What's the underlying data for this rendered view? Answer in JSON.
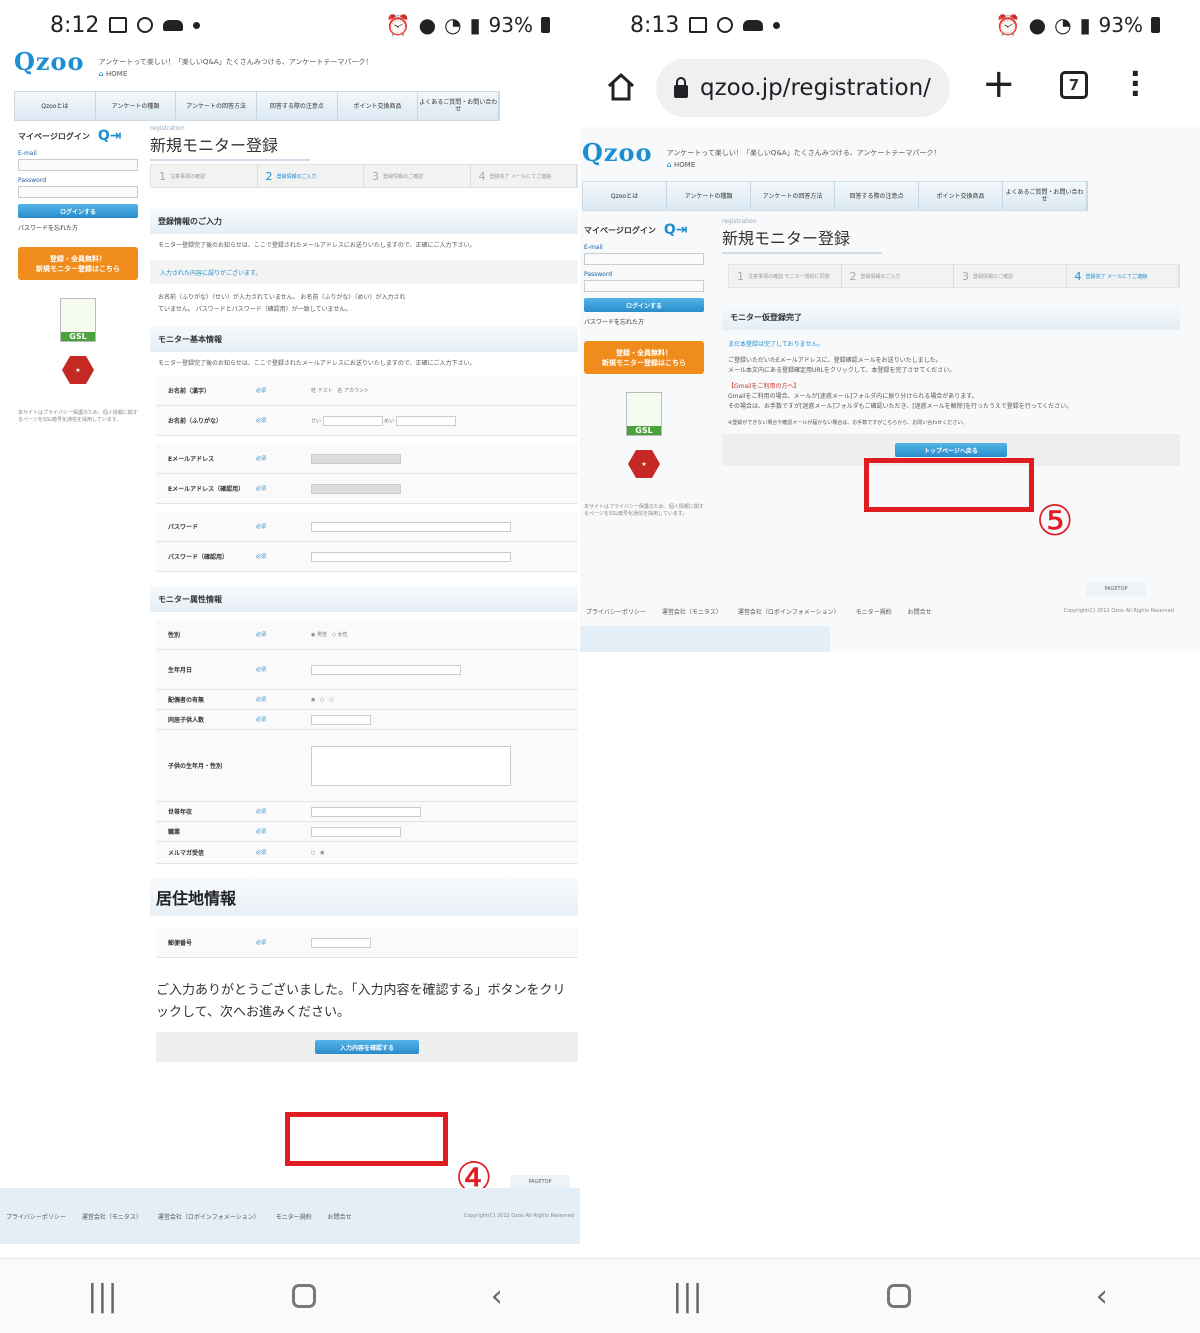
{
  "left": {
    "status": {
      "time": "8:12",
      "battery": "93%"
    },
    "site": {
      "logo_main": "Qzoo",
      "tagline": "アンケートって楽しい！「楽しいQ&A」たくさんみつける、アンケートテーマパーク！",
      "home": "HOME",
      "menu": [
        "Qzooとは",
        "アンケートの種類",
        "アンケートの回答方法",
        "回答する際の注意点",
        "ポイント交換商品",
        "よくあるご質問・お問い合わせ"
      ],
      "login_title": "マイページログイン",
      "email_label": "E-mail",
      "password_label": "Password",
      "login_button": "ログインする",
      "forgot": "パスワードを忘れた方",
      "signup_line1": "登録・全員無料！",
      "signup_line2": "新規モニター登録はこちら",
      "badge_gsl": "GSL",
      "side_note": "本サイトはプライバシー保護のため、個人情報に関するページをSSL暗号化通信を採用しています。",
      "reg_small": "registration",
      "page_title": "新規モニター登録",
      "steps": [
        {
          "label": "STEP",
          "num": "1",
          "text": "注意事項の確認"
        },
        {
          "label": "STEP",
          "num": "2",
          "text": "登録情報のご入力"
        },
        {
          "label": "STEP",
          "num": "3",
          "text": "登録情報のご確認"
        },
        {
          "label": "STEP",
          "num": "4",
          "text": "登録完了 メールにてご連絡"
        }
      ],
      "sec1": "登録情報のご入力",
      "sec1_text": "モニター登録完了後のお知らせは、ここで登録されたメールアドレスにお送りいたしますので、正確にご入力下さい。",
      "warning": "入力された内容に誤りがございます。",
      "errors": "お名前（ふりがな）（せい）が入力されていません。 お名前（ふりがな）（めい）が入力されていません。 パスワードとパスワード（確認用）が一致していません。",
      "sec2": "モニター基本情報",
      "sec2_text": "モニター登録完了後のお知らせは、ここで登録されたメールアドレスにお送りいたしますので、正確にご入力下さい。",
      "required": "必須",
      "basic_rows": [
        "お名前（漢字）",
        "お名前（ふりがな）",
        "Eメールアドレス",
        "Eメールアドレス（確認用）",
        "パスワード",
        "パスワード（確認用）"
      ],
      "name_values": [
        "テスト",
        "アカウント"
      ],
      "sec3": "モニター属性情報",
      "attr_rows": [
        "性別",
        "生年月日",
        "配偶者の有無",
        "同居子供人数",
        "子供の生年月・性別",
        "世帯年収",
        "職業",
        "メルマガ受信"
      ],
      "sec4": "居住地情報",
      "zip_label": "郵便番号",
      "thanks": "ご入力ありがとうございました。「入力内容を確認する」ボタンをクリックして、次へお進みください。",
      "submit_button": "入力内容を確認する",
      "step_marker": "④",
      "pagetop": "PAGETOP",
      "footer_links": [
        "プライバシーポリシー",
        "運営会社（モニタス）",
        "運営会社（ロボインフォメーション）",
        "モニター規約",
        "お問合せ"
      ],
      "copyright": "Copyright(C) 2012 Qzoo All Rights Reserved"
    }
  },
  "right": {
    "status": {
      "time": "8:13",
      "battery": "93%"
    },
    "browser": {
      "url": "qzoo.jp/registration/",
      "tab_count": "7"
    },
    "site": {
      "logo_main": "Qzoo",
      "tagline": "アンケートって楽しい！「楽しいQ&A」たくさんみつける、アンケートテーマパーク！",
      "home": "HOME",
      "menu": [
        "Qzooとは",
        "アンケートの種類",
        "アンケートの回答方法",
        "回答する際の注意点",
        "ポイント交換商品",
        "よくあるご質問・お問い合わせ"
      ],
      "login_title": "マイページログイン",
      "email_label": "E-mail",
      "password_label": "Password",
      "login_button": "ログインする",
      "forgot": "パスワードを忘れた方",
      "signup_line1": "登録・全員無料！",
      "signup_line2": "新規モニター登録はこちら",
      "badge_gsl": "GSL",
      "side_note": "本サイトはプライバシー保護のため、個人情報に関するページをSSL暗号化通信を採用しています。",
      "reg_small": "registration",
      "page_title": "新規モニター登録",
      "steps": [
        {
          "label": "STEP",
          "num": "1",
          "text": "注意事項の確認 モニター規約に同意"
        },
        {
          "label": "STEP",
          "num": "2",
          "text": "登録情報のご入力"
        },
        {
          "label": "STEP",
          "num": "3",
          "text": "登録情報のご確認"
        },
        {
          "label": "STEP",
          "num": "4",
          "text": "登録完了 メールにてご連絡"
        }
      ],
      "sec": "モニター仮登録完了",
      "done_line1": "まだ本登録は完了しておりません。",
      "done_line2": "ご登録いただいたEメールアドレスに、登録確認メールをお送りいたしました。",
      "done_line3": "メール本文内にある登録確定用URLをクリックして、本登録を完了させてください。",
      "gmail_head": "【Gmailをご利用の方へ】",
      "gmail_line1": "Gmailをご利用の場合、メールが[迷惑メール]フォルダ内に振り分けられる場合があります。",
      "gmail_line2": "その場合は、お手数ですが[迷惑メール]フォルダもご確認いただき、[迷惑メールを解除]を行ったうえで登録を行ってください。",
      "note": "※登録ができない場合や確認メールが届かない場合は、お手数ですがこちらから、お問い合わせください。",
      "top_button": "トップページへ戻る",
      "step_marker": "⑤",
      "pagetop": "PAGETOP",
      "footer_links": [
        "プライバシーポリシー",
        "運営会社（モニタス）",
        "運営会社（ロボインフォメーション）",
        "モニター規約",
        "お問合せ"
      ],
      "copyright": "Copyright(C) 2012 Qzoo All Rights Reserved"
    }
  }
}
